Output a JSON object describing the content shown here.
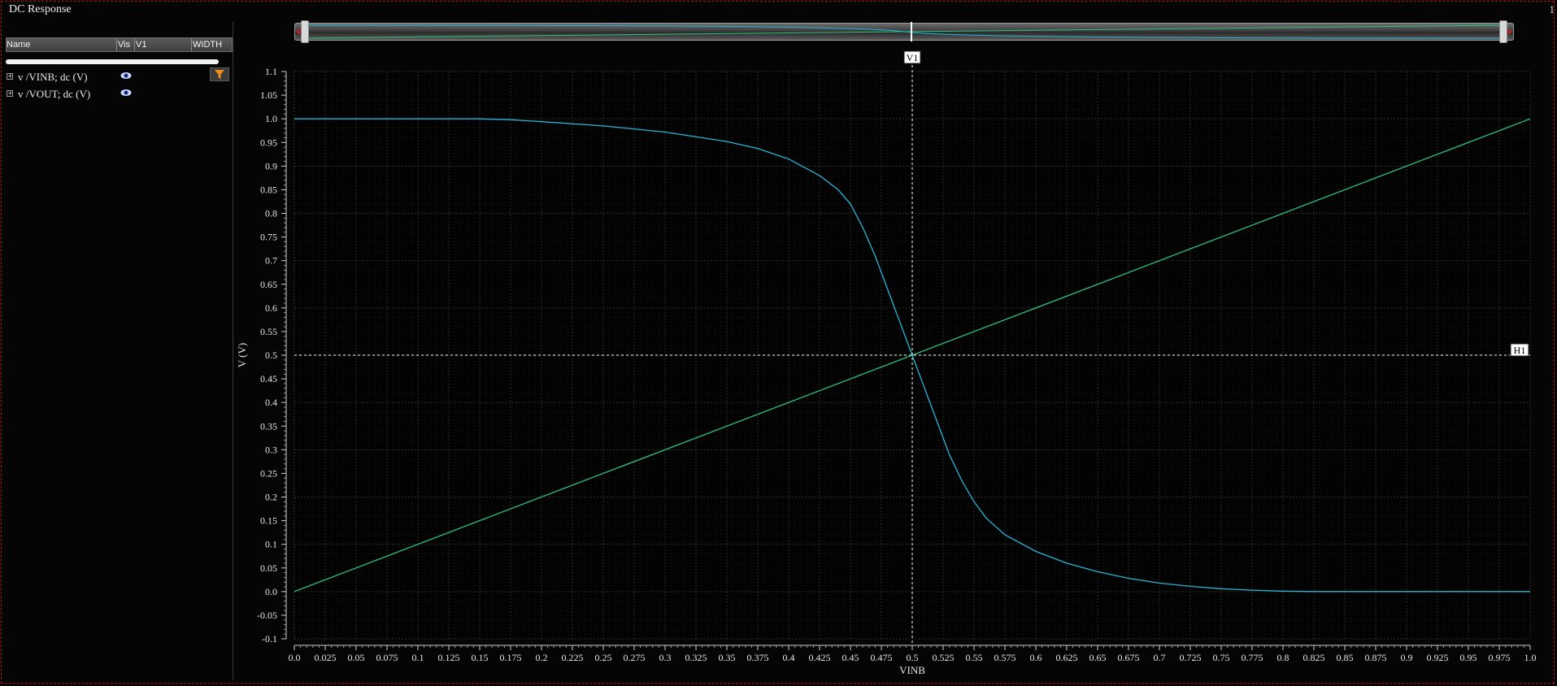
{
  "window": {
    "title": "DC Response",
    "corner_label": "1"
  },
  "signal_table": {
    "columns": [
      "Name",
      "Vis",
      "V1",
      "WIDTH"
    ],
    "rows": [
      {
        "name": "v /VINB; dc (V)",
        "visible": true,
        "color": "#2ec27e"
      },
      {
        "name": "v /VOUT; dc (V)",
        "visible": true,
        "color": "#29b6d6"
      }
    ],
    "filter_icon": "filter-icon"
  },
  "overview_icon": "range-slider",
  "markers": {
    "vertical": {
      "label": "V1",
      "x": 0.5
    },
    "horizontal": {
      "label": "H1",
      "y": 0.5
    }
  },
  "chart_data": {
    "type": "line",
    "xlabel": "VINB",
    "ylabel": "V (V)",
    "xlim": [
      0.0,
      1.0
    ],
    "ylim": [
      -0.1,
      1.1
    ],
    "x_ticks": [
      "0.0",
      "0.025",
      "0.05",
      "0.075",
      "0.1",
      "0.125",
      "0.15",
      "0.175",
      "0.2",
      "0.225",
      "0.25",
      "0.275",
      "0.3",
      "0.325",
      "0.35",
      "0.375",
      "0.4",
      "0.425",
      "0.45",
      "0.475",
      "0.5",
      "0.525",
      "0.55",
      "0.575",
      "0.6",
      "0.625",
      "0.65",
      "0.675",
      "0.7",
      "0.725",
      "0.75",
      "0.775",
      "0.8",
      "0.825",
      "0.85",
      "0.875",
      "0.9",
      "0.925",
      "0.95",
      "0.975",
      "1.0"
    ],
    "y_ticks": [
      "1.1",
      "1.05",
      "1.0",
      "0.95",
      "0.9",
      "0.85",
      "0.8",
      "0.75",
      "0.7",
      "0.65",
      "0.6",
      "0.55",
      "0.5",
      "0.45",
      "0.4",
      "0.35",
      "0.3",
      "0.25",
      "0.2",
      "0.15",
      "0.1",
      "0.05",
      "0.0",
      "-0.05",
      "-0.1"
    ],
    "grid": true,
    "series": [
      {
        "name": "v /VINB; dc (V)",
        "color": "#2ec27e",
        "x": [
          0.0,
          1.0
        ],
        "y": [
          0.0,
          1.0
        ]
      },
      {
        "name": "v /VOUT; dc (V)",
        "color": "#29b6d6",
        "x": [
          0.0,
          0.1,
          0.15,
          0.175,
          0.2,
          0.25,
          0.3,
          0.35,
          0.375,
          0.4,
          0.425,
          0.44,
          0.45,
          0.46,
          0.47,
          0.48,
          0.49,
          0.5,
          0.51,
          0.52,
          0.53,
          0.54,
          0.55,
          0.56,
          0.575,
          0.6,
          0.625,
          0.65,
          0.675,
          0.7,
          0.725,
          0.75,
          0.775,
          0.8,
          0.825,
          0.85,
          0.9,
          1.0
        ],
        "y": [
          1.0,
          1.0,
          1.0,
          0.998,
          0.994,
          0.985,
          0.972,
          0.952,
          0.937,
          0.915,
          0.88,
          0.85,
          0.82,
          0.77,
          0.71,
          0.64,
          0.57,
          0.5,
          0.43,
          0.36,
          0.29,
          0.235,
          0.19,
          0.155,
          0.12,
          0.085,
          0.06,
          0.042,
          0.028,
          0.018,
          0.011,
          0.006,
          0.003,
          0.001,
          0.0,
          0.0,
          0.0,
          0.0
        ]
      }
    ]
  }
}
